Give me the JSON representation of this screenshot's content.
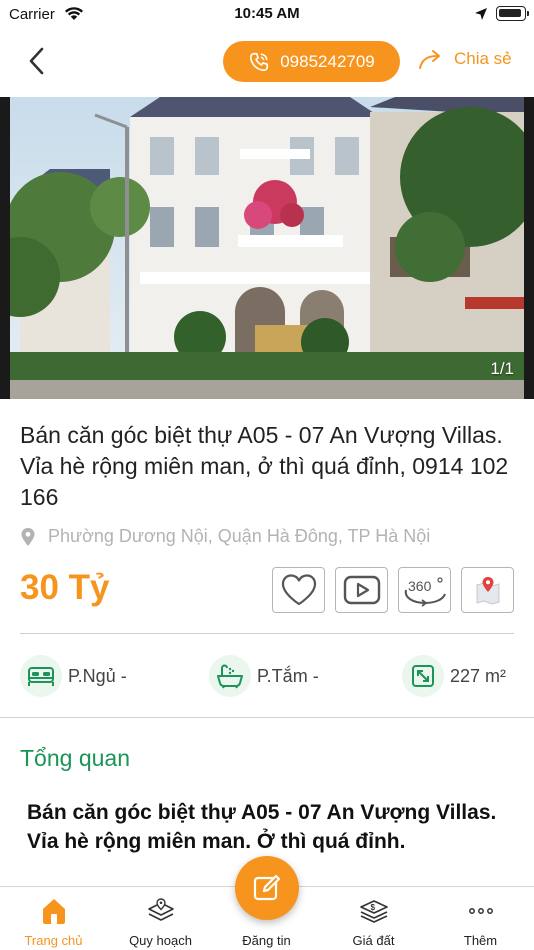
{
  "status_bar": {
    "carrier": "Carrier",
    "time": "10:45 AM"
  },
  "header": {
    "phone": "0985242709",
    "share_label": "Chia sẻ",
    "accent_color": "#f7941d"
  },
  "photo": {
    "counter": "1/1"
  },
  "listing": {
    "title": "Bán căn góc biệt thự A05 - 07 An Vượng Villas. Vỉa hè rộng miên man, ở thì quá đỉnh, 0914 102 166",
    "address": "Phường Dương Nội, Quận Hà Đông, TP Hà Nội",
    "price": "30 Tỷ",
    "actions": [
      "heart-icon",
      "video-play-icon",
      "view-360-icon",
      "map-pin-icon"
    ],
    "features": [
      {
        "icon": "bed-icon",
        "label": "P.Ngủ -"
      },
      {
        "icon": "bathtub-icon",
        "label": "P.Tắm -"
      },
      {
        "icon": "area-icon",
        "label": "227 m²"
      }
    ],
    "section_title": "Tổng quan",
    "overview": "Bán căn góc biệt thự A05 - 07 An Vượng Villas. Vỉa hè rộng miên man. Ở thì quá đỉnh.",
    "section_color": "#1b9457"
  },
  "tab_bar": {
    "tabs": [
      {
        "label": "Trang chủ",
        "active": true
      },
      {
        "label": "Quy hoạch"
      },
      {
        "label": "Đăng tin"
      },
      {
        "label": "Giá đất"
      },
      {
        "label": "Thêm"
      }
    ]
  }
}
